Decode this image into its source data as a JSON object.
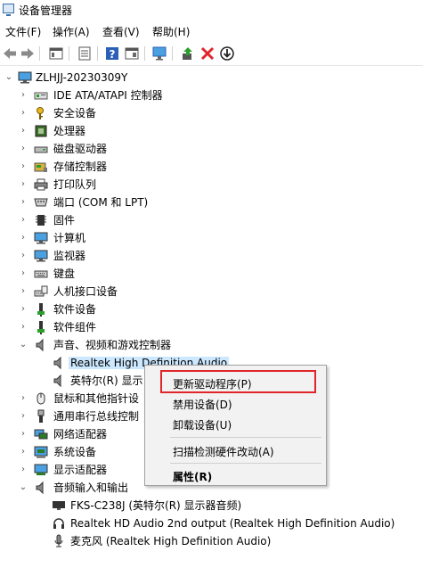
{
  "window": {
    "title": "设备管理器"
  },
  "menubar": {
    "items": [
      "文件(F)",
      "操作(A)",
      "查看(V)",
      "帮助(H)"
    ]
  },
  "toolbar": {
    "buttons": [
      "back-icon",
      "forward-icon",
      "properties-pane-icon",
      "list-icon",
      "help-icon",
      "action-pane-icon",
      "monitor-icon",
      "update-driver-icon",
      "uninstall-icon",
      "download-icon"
    ]
  },
  "tree": {
    "root": "ZLHJJ-20230309Y",
    "items": [
      {
        "label": "IDE ATA/ATAPI 控制器"
      },
      {
        "label": "安全设备"
      },
      {
        "label": "处理器"
      },
      {
        "label": "磁盘驱动器"
      },
      {
        "label": "存储控制器"
      },
      {
        "label": "打印队列"
      },
      {
        "label": "端口 (COM 和 LPT)"
      },
      {
        "label": "固件"
      },
      {
        "label": "计算机"
      },
      {
        "label": "监视器"
      },
      {
        "label": "键盘"
      },
      {
        "label": "人机接口设备"
      },
      {
        "label": "软件设备"
      },
      {
        "label": "软件组件"
      },
      {
        "label": "声音、视频和游戏控制器"
      },
      {
        "label": "Realtek High Definition Audio"
      },
      {
        "label": "英特尔(R) 显示"
      },
      {
        "label": "鼠标和其他指针设"
      },
      {
        "label": "通用串行总线控制"
      },
      {
        "label": "网络适配器"
      },
      {
        "label": "系统设备"
      },
      {
        "label": "显示适配器"
      },
      {
        "label": "音频输入和输出"
      },
      {
        "label": "FKS-C238J (英特尔(R) 显示器音频)"
      },
      {
        "label": "Realtek HD Audio 2nd output (Realtek High Definition Audio)"
      },
      {
        "label": "麦克风 (Realtek High Definition Audio)"
      }
    ]
  },
  "context_menu": {
    "items": [
      "更新驱动程序(P)",
      "禁用设备(D)",
      "卸载设备(U)",
      "扫描检测硬件改动(A)",
      "属性(R)"
    ]
  }
}
